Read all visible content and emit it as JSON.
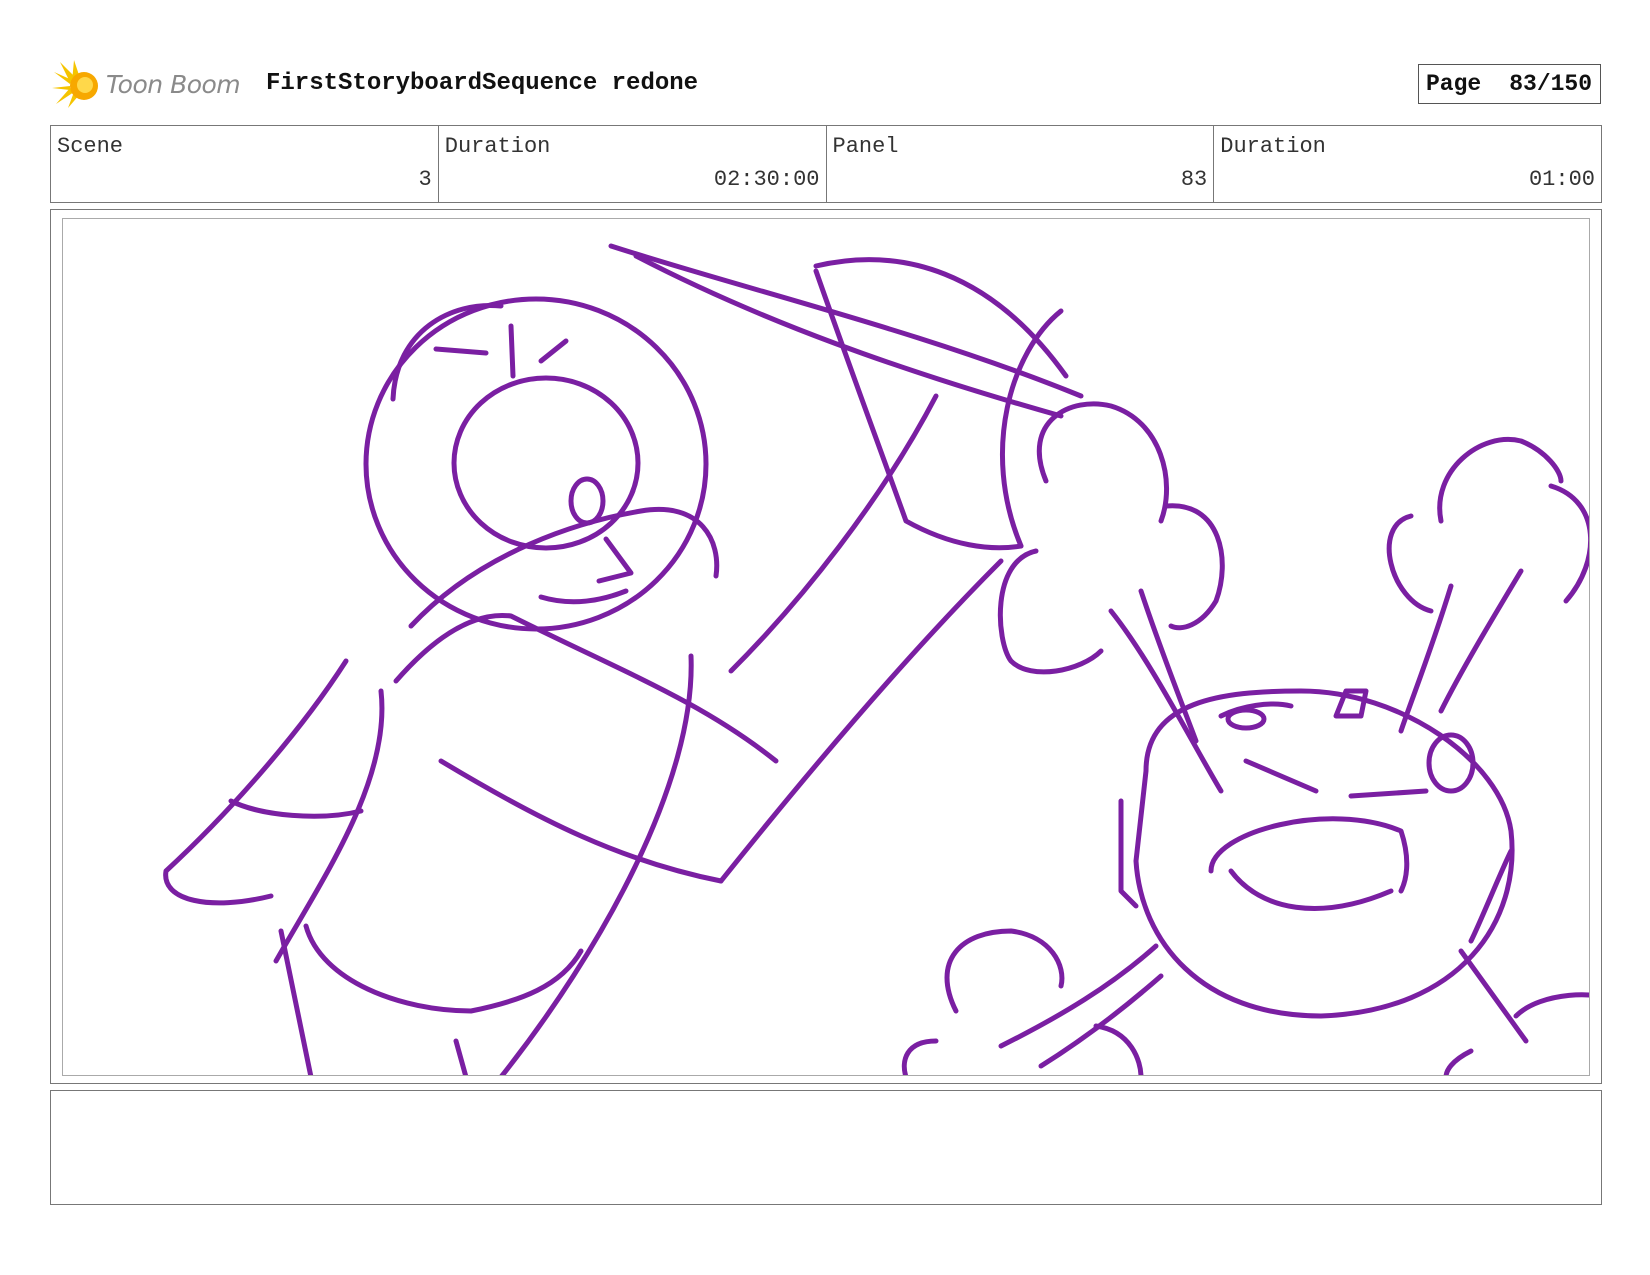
{
  "header": {
    "logo_text": "Toon Boom",
    "sequence_title": "FirstStoryboardSequence redone",
    "page_label": "Page",
    "page_number": "83/150"
  },
  "info": {
    "scene_label": "Scene",
    "scene_value": "3",
    "scene_duration_label": "Duration",
    "scene_duration_value": "02:30:00",
    "panel_label": "Panel",
    "panel_value": "83",
    "panel_duration_label": "Duration",
    "panel_duration_value": "01:00"
  },
  "notes": {
    "text": ""
  },
  "colors": {
    "sketch_stroke": "#7a1fa2",
    "logo_accent": "#f5c400"
  }
}
